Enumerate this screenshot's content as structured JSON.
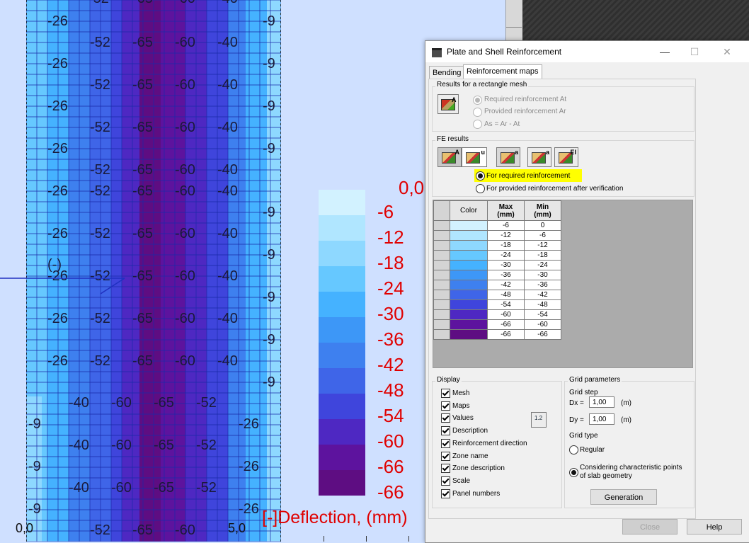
{
  "map": {
    "rows": [
      {
        "a": "-26",
        "b": "-52",
        "c": "-65",
        "d": "-60",
        "e": "-40",
        "f": "-9"
      },
      {
        "a": "-26",
        "b": "-52",
        "c": "-65",
        "d": "-60",
        "e": "-40",
        "f": "-9"
      },
      {
        "a": "-26",
        "b": "-52",
        "c": "-65",
        "d": "-60",
        "e": "-40",
        "f": "-9"
      },
      {
        "a": "-26",
        "b": "-52",
        "c": "-65",
        "d": "-60",
        "e": "-40",
        "f": "-9"
      },
      {
        "a": "-26",
        "b": "-52",
        "c": "-65",
        "d": "-60",
        "e": "-40",
        "f": "-9"
      },
      {
        "a": "-26",
        "b": "-52",
        "c": "-65",
        "d": "-60",
        "e": "-40",
        "f": "-9"
      },
      {
        "a": "-26",
        "b": "-52",
        "c": "-65",
        "d": "-60",
        "e": "-40",
        "f": "-9"
      },
      {
        "a": "-26",
        "b": "-52",
        "c": "-65",
        "d": "-60",
        "e": "-40",
        "f": "-9"
      },
      {
        "a": "-26",
        "b": "-52",
        "c": "-65",
        "d": "-60",
        "e": "-40",
        "f": "-9"
      }
    ],
    "rows2": [
      {
        "a": "-40",
        "b": "-60",
        "c": "-65",
        "d": "-52",
        "l": "-9",
        "r": "-26"
      },
      {
        "a": "-40",
        "b": "-60",
        "c": "-65",
        "d": "-52",
        "l": "-9",
        "r": "-26"
      },
      {
        "a": "-40",
        "b": "-60",
        "c": "-65",
        "d": "-52",
        "l": "-9",
        "r": "-26"
      }
    ],
    "top_partial": [
      "-52",
      "-65",
      "-60",
      "-40"
    ],
    "bottom_partial": [
      "-52",
      "-65",
      "-60"
    ],
    "minus_sign": "(-)",
    "coord_left": "0,0",
    "coord_right": "5,0"
  },
  "legend": {
    "top_value": "0,0",
    "labels": [
      "-6",
      "-12",
      "-18",
      "-24",
      "-30",
      "-36",
      "-42",
      "-48",
      "-54",
      "-60",
      "-66",
      "-66"
    ],
    "colors": [
      "#d2f2ff",
      "#b0e6ff",
      "#8ed8ff",
      "#66c8ff",
      "#45b2ff",
      "#3d97f7",
      "#3e80ef",
      "#3f65e8",
      "#3f45dc",
      "#4e28c2",
      "#5d139e",
      "#5e0d82"
    ],
    "caption": "[-]Deflection, (mm)"
  },
  "dialog": {
    "title": "Plate and Shell Reinforcement",
    "min_btn": "—",
    "max_btn": "☐",
    "close_btn": "✕",
    "tabs": [
      "Bending",
      "Reinforcement maps"
    ],
    "rect_mesh": {
      "title": "Results for a rectangle mesh",
      "options": [
        "Required reinforcement At",
        "Provided reinforcement Ar",
        "As = Ar - At"
      ]
    },
    "fe": {
      "title": "FE results",
      "icon_labels": [
        "A",
        "u",
        "a",
        "a",
        "EI"
      ],
      "options": [
        "For required reinforcement",
        "For provided reinforcement after verification"
      ],
      "highlight_color": "#ffff00"
    },
    "table": {
      "headers": [
        "Color",
        "Max\n(mm)",
        "Min\n(mm)"
      ],
      "rows": [
        {
          "max": "-6",
          "min": "0",
          "color": "#d2f2ff"
        },
        {
          "max": "-12",
          "min": "-6",
          "color": "#b0e6ff"
        },
        {
          "max": "-18",
          "min": "-12",
          "color": "#8ed8ff"
        },
        {
          "max": "-24",
          "min": "-18",
          "color": "#66c8ff"
        },
        {
          "max": "-30",
          "min": "-24",
          "color": "#45b2ff"
        },
        {
          "max": "-36",
          "min": "-30",
          "color": "#3d97f7"
        },
        {
          "max": "-42",
          "min": "-36",
          "color": "#3e80ef"
        },
        {
          "max": "-48",
          "min": "-42",
          "color": "#3f65e8"
        },
        {
          "max": "-54",
          "min": "-48",
          "color": "#3f45dc"
        },
        {
          "max": "-60",
          "min": "-54",
          "color": "#4e28c2"
        },
        {
          "max": "-66",
          "min": "-60",
          "color": "#5d139e"
        },
        {
          "max": "-66",
          "min": "-66",
          "color": "#5e0d82"
        }
      ]
    },
    "display": {
      "title": "Display",
      "items": [
        "Mesh",
        "Maps",
        "Values",
        "Description",
        "Reinforcement direction",
        "Zone name",
        "Zone description",
        "Scale",
        "Panel numbers"
      ]
    },
    "grid": {
      "title": "Grid parameters",
      "step_label": "Grid step",
      "dx_label": "Dx =",
      "dx_value": "1,00",
      "dx_unit": "(m)",
      "dy_label": "Dy =",
      "dy_value": "1,00",
      "dy_unit": "(m)",
      "type_label": "Grid type",
      "regular": "Regular",
      "considering": "Considering characteristic points of slab geometry",
      "generation": "Generation"
    },
    "close": "Close",
    "help": "Help"
  }
}
